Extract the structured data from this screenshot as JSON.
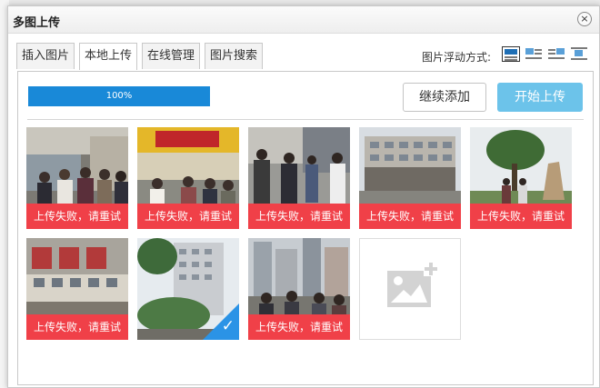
{
  "dialog": {
    "title": "多图上传",
    "close_glyph": "×"
  },
  "tabs": [
    {
      "label": "插入图片"
    },
    {
      "label": "本地上传"
    },
    {
      "label": "在线管理"
    },
    {
      "label": "图片搜索"
    }
  ],
  "float_mode": {
    "label": "图片浮动方式:",
    "options": [
      "none-icon",
      "left-icon",
      "right-icon",
      "center-icon"
    ],
    "selected": "none-icon"
  },
  "upload": {
    "progress_percent": 100,
    "progress_text": "100%",
    "continue_label": "继续添加",
    "start_label": "开始上传"
  },
  "images": [
    {
      "status": "上传失败，请重试"
    },
    {
      "status": "上传失败，请重试"
    },
    {
      "status": "上传失败，请重试"
    },
    {
      "status": "上传失败，请重试"
    },
    {
      "status": "上传失败，请重试"
    },
    {
      "status": "上传失败，请重试"
    },
    {
      "status": "",
      "selected": true
    },
    {
      "status": "上传失败，请重试"
    }
  ],
  "colors": {
    "accent": "#1989d8",
    "start_button": "#6cc3ea",
    "error": "#f04048"
  }
}
